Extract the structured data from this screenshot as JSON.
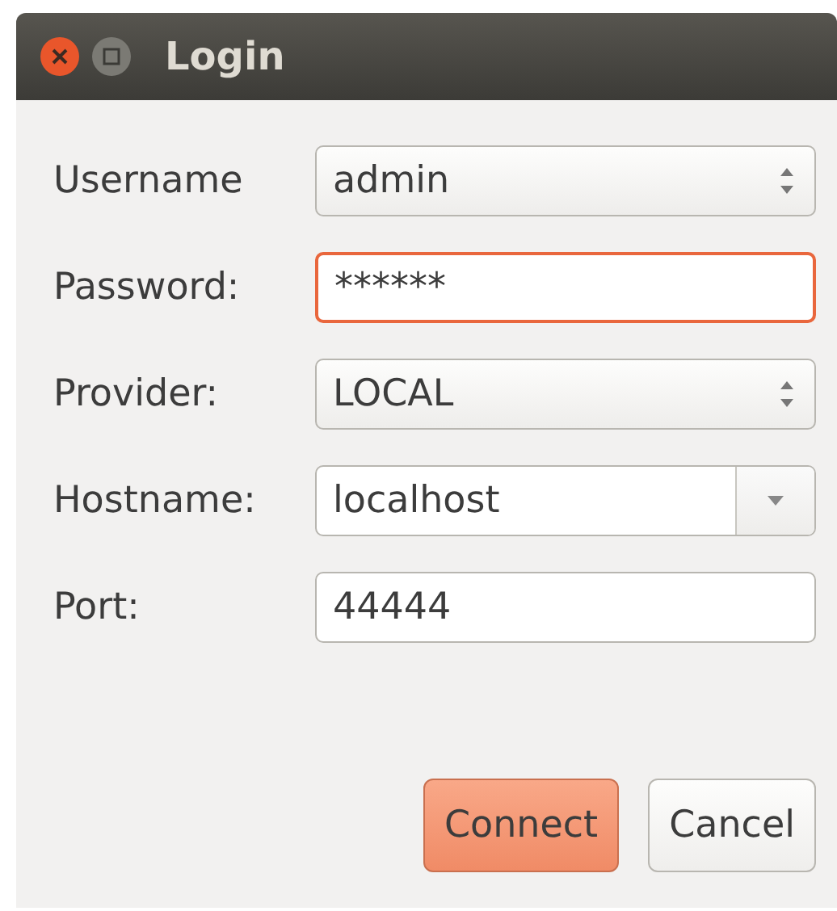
{
  "window": {
    "title": "Login"
  },
  "fields": [
    {
      "label": "Username",
      "kind": "spin",
      "value": "admin",
      "focused": false
    },
    {
      "label": "Password:",
      "kind": "text",
      "value": "******",
      "focused": true
    },
    {
      "label": "Provider:",
      "kind": "spin",
      "value": "LOCAL",
      "focused": false
    },
    {
      "label": "Hostname:",
      "kind": "combo",
      "value": "localhost",
      "focused": false
    },
    {
      "label": "Port:",
      "kind": "text",
      "value": "44444",
      "focused": false
    }
  ],
  "buttons": [
    {
      "label": "Connect",
      "default": true
    },
    {
      "label": "Cancel",
      "default": false
    }
  ]
}
